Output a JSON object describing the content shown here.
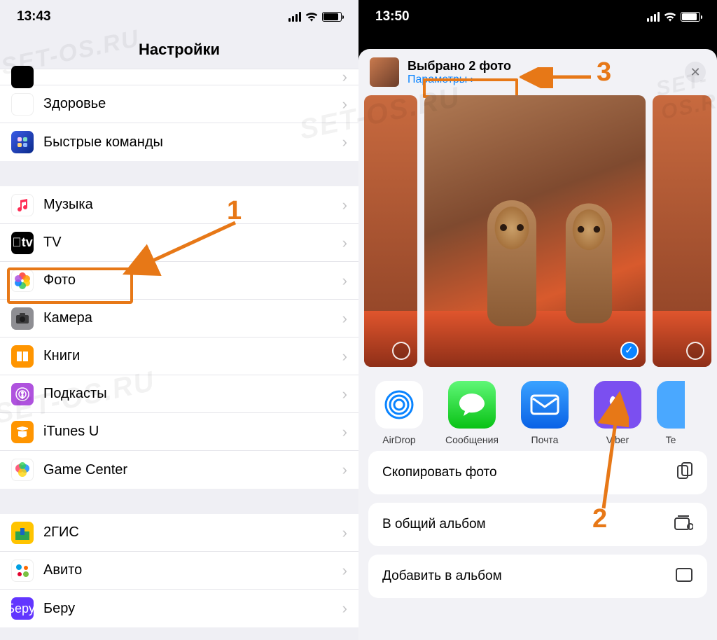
{
  "left": {
    "time": "13:43",
    "title": "Настройки",
    "rows1": [
      {
        "label": "Здоровье"
      },
      {
        "label": "Быстрые команды"
      }
    ],
    "rows2": [
      {
        "label": "Музыка"
      },
      {
        "label": "TV"
      },
      {
        "label": "Фото"
      },
      {
        "label": "Камера"
      },
      {
        "label": "Книги"
      },
      {
        "label": "Подкасты"
      },
      {
        "label": "iTunes U"
      },
      {
        "label": "Game Center"
      }
    ],
    "rows3": [
      {
        "label": "2ГИС"
      },
      {
        "label": "Авито"
      },
      {
        "label": "Беру"
      }
    ]
  },
  "right": {
    "time": "13:50",
    "selected_title": "Выбрано 2 фото",
    "options_label": "Параметры",
    "apps": [
      {
        "label": "AirDrop"
      },
      {
        "label": "Сообщения"
      },
      {
        "label": "Почта"
      },
      {
        "label": "Viber"
      },
      {
        "label": "Te"
      }
    ],
    "actions": [
      {
        "label": "Скопировать фото"
      },
      {
        "label": "В общий альбом"
      },
      {
        "label": "Добавить в альбом"
      }
    ]
  },
  "annotations": {
    "n1": "1",
    "n2": "2",
    "n3": "3"
  },
  "watermark": "SET-OS.RU"
}
